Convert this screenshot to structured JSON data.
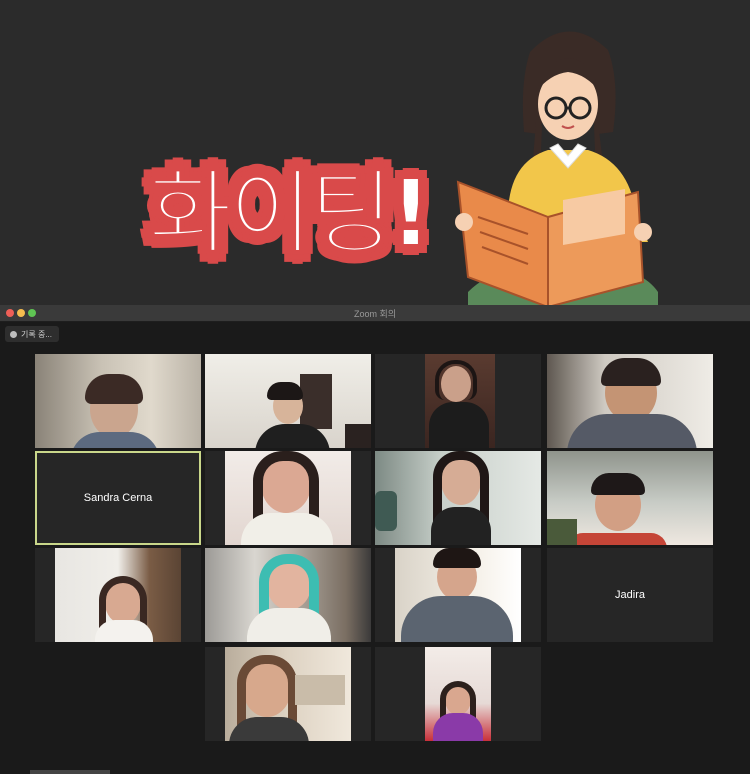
{
  "sticker": {
    "text": "화이팅!",
    "colors": {
      "outline": "#d94a4a",
      "fill": "#ffffff"
    }
  },
  "window": {
    "title": "Zoom 회의",
    "recording_label": "기록 중..."
  },
  "participants": [
    {
      "name": "",
      "video": true
    },
    {
      "name": "",
      "video": true
    },
    {
      "name": "",
      "video": true
    },
    {
      "name": "",
      "video": true
    },
    {
      "name": "Sandra Cerna",
      "video": false,
      "active_speaker": true
    },
    {
      "name": "",
      "video": true
    },
    {
      "name": "",
      "video": true
    },
    {
      "name": "",
      "video": true
    },
    {
      "name": "",
      "video": true
    },
    {
      "name": "",
      "video": true
    },
    {
      "name": "",
      "video": true
    },
    {
      "name": "Jadira",
      "video": false
    },
    {
      "name": "",
      "video": true
    },
    {
      "name": "",
      "video": true
    }
  ],
  "colors": {
    "accent_active": "#c9d78a",
    "background": "#1a1a1a",
    "tile": "#262626"
  }
}
